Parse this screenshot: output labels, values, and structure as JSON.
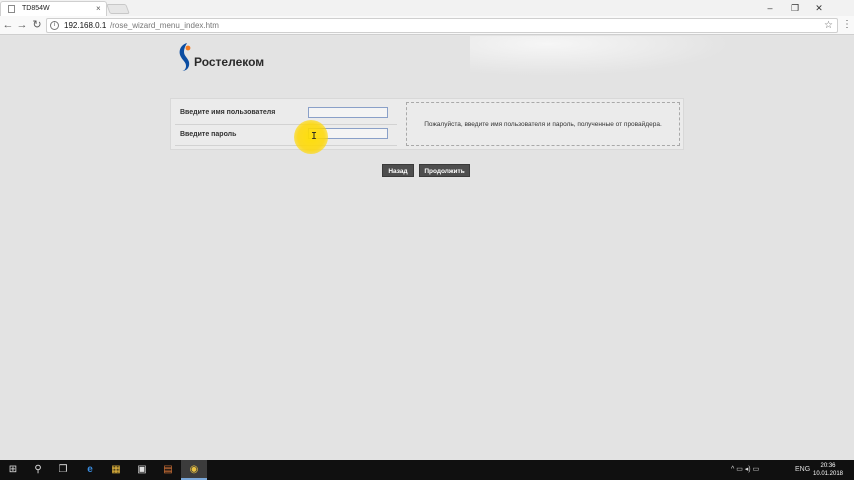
{
  "browser": {
    "tab_title": "TD854W",
    "tab_close": "×",
    "url_host": "192.168.0.1",
    "url_path": "/rose_wizard_menu_index.htm",
    "window_controls": [
      "–",
      "❐",
      "✕"
    ],
    "nav": {
      "back": "←",
      "forward": "→",
      "reload": "↻"
    },
    "info_icon": "i",
    "star": "☆",
    "menu": "⋮"
  },
  "logo": {
    "text": "Ростелеком",
    "brand_colors": [
      "#0b4da2",
      "#f47a20"
    ]
  },
  "form": {
    "username_label": "Введите имя пользователя",
    "password_label": "Введите пароль",
    "username_value": "",
    "password_value": "",
    "hint": "Пожалуйста, введите имя пользователя и пароль, полученные от провайдера."
  },
  "buttons": {
    "back": "Назад",
    "continue": "Продолжить"
  },
  "cursor": {
    "glyph": "I"
  },
  "taskbar": {
    "icons": [
      "⊞",
      "⚲",
      "❐",
      "e",
      "▦",
      "▣",
      "▤",
      "◉"
    ],
    "language": "ENG",
    "time": "20:36",
    "date": "10.01.2018",
    "tray_symbols": "^ ▭ ◂) ▭"
  }
}
